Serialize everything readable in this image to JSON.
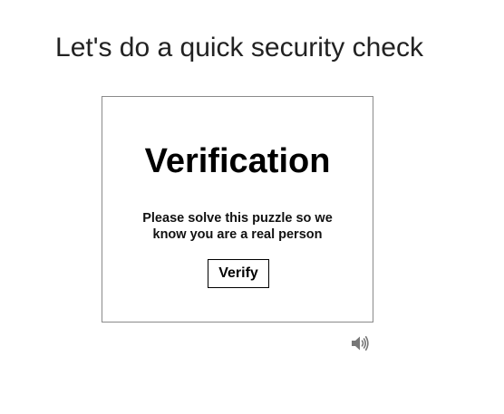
{
  "page": {
    "heading": "Let's do a quick security check"
  },
  "challenge": {
    "title": "Verification",
    "description": "Please solve this puzzle so we know you are a real person",
    "verify_label": "Verify"
  },
  "audio": {
    "icon": "speaker-icon"
  },
  "colors": {
    "frame_border": "#8a8a8a",
    "text": "#000000",
    "icon": "#777777"
  }
}
